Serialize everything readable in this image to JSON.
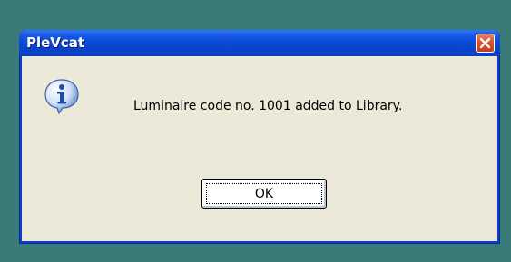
{
  "window": {
    "title": "PleVcat",
    "close_icon": "close-icon"
  },
  "dialog": {
    "icon": "info-icon",
    "message": "Luminaire code no. 1001 added to Library.",
    "ok_label": "OK"
  },
  "colors": {
    "desktop": "#3a7b77",
    "titlebar": "#0a44cd",
    "client": "#ece9d8",
    "close_button": "#d8522f"
  }
}
